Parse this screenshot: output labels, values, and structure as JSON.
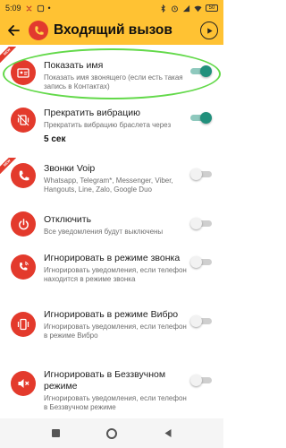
{
  "status_bar": {
    "time": "5:09",
    "battery": "50"
  },
  "toolbar": {
    "title": "Входящий вызов"
  },
  "new_badge": "NEW",
  "settings": [
    {
      "title": "Показать имя",
      "subtitle": "Показать имя звонящего (если есть такая запись в Контактах)",
      "extra": "",
      "enabled": true,
      "icon": "contact-card-icon",
      "new": true
    },
    {
      "title": "Прекратить вибрацию",
      "subtitle": "Прекратить вибрацию браслета через",
      "extra": "5 сек",
      "enabled": true,
      "icon": "vibration-off-icon",
      "new": false
    },
    {
      "title": "Звонки Voip",
      "subtitle": "Whatsapp, Telegram*, Messenger, Viber, Hangouts, Line, Zalo, Google Duo",
      "extra": "",
      "enabled": false,
      "icon": "phone-icon",
      "new": true
    },
    {
      "title": "Отключить",
      "subtitle": "Все уведомления будут выключены",
      "extra": "",
      "enabled": false,
      "icon": "power-icon",
      "new": false
    },
    {
      "title": "Игнорировать в режиме звонка",
      "subtitle": "Игнорировать уведомления, если телефон находится в режиме звонка",
      "extra": "",
      "enabled": false,
      "icon": "ringing-phone-icon",
      "new": false
    },
    {
      "title": "Игнорировать в режиме Вибро",
      "subtitle": "Игнорировать уведомления, если телефон в режиме Вибро",
      "extra": "",
      "enabled": false,
      "icon": "vibrate-phone-icon",
      "new": false
    },
    {
      "title": "Игнорировать в Беззвучном режиме",
      "subtitle": "Игнорировать уведомления, если телефон в Беззвучном режиме",
      "extra": "",
      "enabled": false,
      "icon": "mute-icon",
      "new": false
    }
  ],
  "colors": {
    "accent": "#ffc233",
    "icon_bg": "#e33a2c",
    "switch_on": "#21907c",
    "highlight": "#63d94a"
  }
}
